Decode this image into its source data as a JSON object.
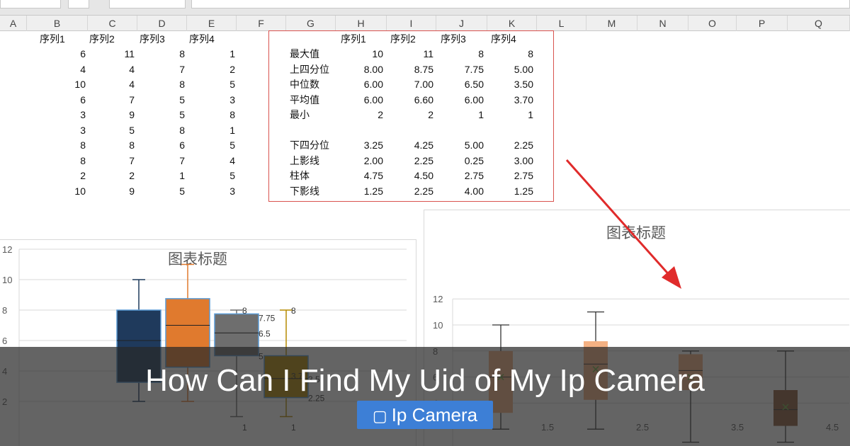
{
  "columns": [
    "A",
    "B",
    "C",
    "D",
    "E",
    "F",
    "G",
    "H",
    "I",
    "J",
    "K",
    "L",
    "M",
    "N",
    "O",
    "P",
    "Q"
  ],
  "data_table": {
    "headers": [
      "序列1",
      "序列2",
      "序列3",
      "序列4"
    ],
    "rows": [
      [
        "6",
        "11",
        "8",
        "1"
      ],
      [
        "4",
        "4",
        "7",
        "2"
      ],
      [
        "10",
        "4",
        "8",
        "5"
      ],
      [
        "6",
        "7",
        "5",
        "3"
      ],
      [
        "3",
        "9",
        "5",
        "8"
      ],
      [
        "3",
        "5",
        "8",
        "1"
      ],
      [
        "8",
        "8",
        "6",
        "5"
      ],
      [
        "8",
        "7",
        "7",
        "4"
      ],
      [
        "2",
        "2",
        "1",
        "5"
      ],
      [
        "10",
        "9",
        "5",
        "3"
      ]
    ]
  },
  "stats_table": {
    "headers": [
      "序列1",
      "序列2",
      "序列3",
      "序列4"
    ],
    "rows": [
      {
        "label": "最大值",
        "values": [
          "10",
          "11",
          "8",
          "8"
        ]
      },
      {
        "label": "上四分位",
        "values": [
          "8.00",
          "8.75",
          "7.75",
          "5.00"
        ]
      },
      {
        "label": "中位数",
        "values": [
          "6.00",
          "7.00",
          "6.50",
          "3.50"
        ]
      },
      {
        "label": "平均值",
        "values": [
          "6.00",
          "6.60",
          "6.00",
          "3.70"
        ]
      },
      {
        "label": "最小",
        "values": [
          "2",
          "2",
          "1",
          "1"
        ]
      },
      {
        "label": "",
        "values": [
          "",
          "",
          "",
          ""
        ]
      },
      {
        "label": "下四分位",
        "values": [
          "3.25",
          "4.25",
          "5.00",
          "2.25"
        ]
      },
      {
        "label": "上影线",
        "values": [
          "2.00",
          "2.25",
          "0.25",
          "3.00"
        ]
      },
      {
        "label": "柱体",
        "values": [
          "4.75",
          "4.50",
          "2.75",
          "2.75"
        ]
      },
      {
        "label": "下影线",
        "values": [
          "1.25",
          "2.25",
          "4.00",
          "1.25"
        ]
      }
    ]
  },
  "chart_data": [
    {
      "type": "box",
      "title": "图表标题",
      "yticks": [
        "12",
        "10",
        "8",
        "6",
        "4",
        "2"
      ],
      "ylim": [
        0,
        12
      ],
      "series": [
        {
          "min": 2,
          "q1": 3.25,
          "median": 6,
          "q3": 8,
          "max": 10,
          "color": "#1f3a5c"
        },
        {
          "min": 2,
          "q1": 4.25,
          "median": 7,
          "q3": 8.75,
          "max": 11,
          "color": "#e07a2e"
        },
        {
          "min": 1,
          "q1": 5,
          "median": 6.5,
          "q3": 7.75,
          "max": 8,
          "color": "#6e6e6e"
        },
        {
          "min": 1,
          "q1": 2.25,
          "median": 3.5,
          "q3": 5,
          "max": 8,
          "color": "#b58a00"
        }
      ],
      "data_labels": [
        "8",
        "7.75",
        "6.5",
        "5",
        "8",
        "3.7",
        "3.5",
        "2.25",
        "1",
        "1"
      ]
    },
    {
      "type": "box",
      "title": "图表标题",
      "yticks": [
        "12",
        "10",
        "8",
        "6",
        "4"
      ],
      "xticks": [
        "1.5",
        "2.5",
        "3.5",
        "4.5"
      ],
      "ylim": [
        0,
        12
      ],
      "series": [
        {
          "min": 2,
          "q1": 3.25,
          "median": 6,
          "q3": 8,
          "mean": 6,
          "max": 10,
          "color": "#f4b183"
        },
        {
          "min": 2,
          "q1": 4.25,
          "median": 7,
          "q3": 8.75,
          "mean": 6.6,
          "max": 11,
          "color": "#f4b183"
        },
        {
          "min": 1,
          "q1": 5,
          "median": 6.5,
          "q3": 7.75,
          "mean": 6,
          "max": 8,
          "color": "#f4b183"
        },
        {
          "min": 1,
          "q1": 2.25,
          "median": 3.5,
          "q3": 5,
          "mean": 3.7,
          "max": 8,
          "color": "#8b5a3c"
        }
      ]
    }
  ],
  "colors": {
    "accent_red": "#e02b2b",
    "tag_blue": "#3d7fd6"
  },
  "banner": {
    "title": "How Can I Find My Uid of My Ip Camera",
    "tag_icon": "folder-icon",
    "tag_glyph": "▢",
    "tag_label": "Ip Camera"
  }
}
